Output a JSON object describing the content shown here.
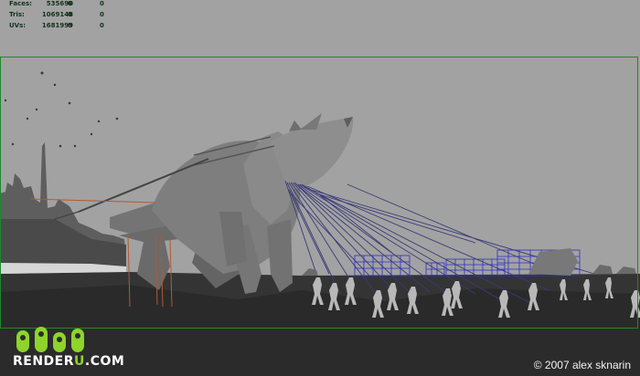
{
  "stats": [
    {
      "label": "Faces:",
      "v1": "535690",
      "v2": "0",
      "v3": "0"
    },
    {
      "label": "Tris:",
      "v1": "1069148",
      "v2": "0",
      "v3": "0"
    },
    {
      "label": "UVs:",
      "v1": "1681999",
      "v2": "0",
      "v3": "0"
    }
  ],
  "watermark": {
    "logo_part1": "RENDER",
    "logo_part2": "U",
    "logo_part3": ".COM",
    "copyright": "© 2007 alex sknarin"
  },
  "colors": {
    "viewport_bg": "#a2a2a2",
    "ground": "#343434",
    "model": "#7e7e7e",
    "rig_wire": "#2b2ba0",
    "frame_green": "#1c8a2a",
    "logo_green": "#8ed42a"
  }
}
